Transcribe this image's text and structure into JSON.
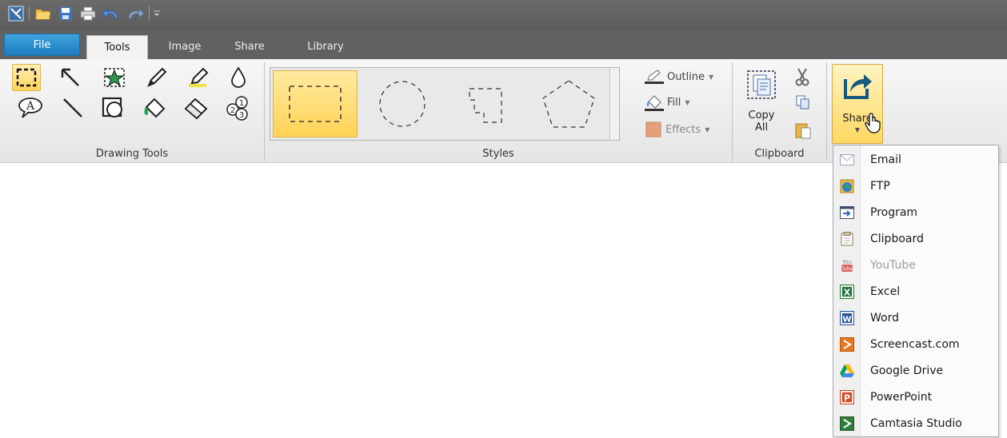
{
  "quick_access": {
    "icons": [
      "snagit-editor-icon",
      "open-folder-icon",
      "save-icon",
      "print-icon",
      "undo-icon",
      "redo-icon",
      "customize-dropdown-icon"
    ]
  },
  "tabs": [
    {
      "label": "File",
      "active": false
    },
    {
      "label": "Tools",
      "active": true
    },
    {
      "label": "Image",
      "active": false
    },
    {
      "label": "Share",
      "active": false
    },
    {
      "label": "Library",
      "active": false
    }
  ],
  "groups": {
    "drawing_tools": {
      "label": "Drawing Tools",
      "tools": [
        "selection-icon",
        "arrow-icon",
        "stamp-icon",
        "pen-icon",
        "highlighter-icon",
        "blur-icon",
        "callout-icon",
        "line-icon",
        "shape-icon",
        "fill-icon",
        "eraser-icon",
        "step-icon"
      ],
      "selected": "selection-icon"
    },
    "styles": {
      "label": "Styles",
      "outline_label": "Outline",
      "fill_label": "Fill",
      "effects_label": "Effects"
    },
    "clipboard": {
      "label": "Clipboard",
      "copy_all_label_1": "Copy",
      "copy_all_label_2": "All"
    },
    "share": {
      "button_label": "Share"
    }
  },
  "share_menu": {
    "items": [
      {
        "label": "Email",
        "icon": "email-icon",
        "enabled": true
      },
      {
        "label": "FTP",
        "icon": "ftp-icon",
        "enabled": true
      },
      {
        "label": "Program",
        "icon": "program-icon",
        "enabled": true
      },
      {
        "label": "Clipboard",
        "icon": "clipboard-icon",
        "enabled": true
      },
      {
        "label": "YouTube",
        "icon": "youtube-icon",
        "enabled": false
      },
      {
        "label": "Excel",
        "icon": "excel-icon",
        "enabled": true
      },
      {
        "label": "Word",
        "icon": "word-icon",
        "enabled": true
      },
      {
        "label": "Screencast.com",
        "icon": "screencast-icon",
        "enabled": true
      },
      {
        "label": "Google Drive",
        "icon": "google-drive-icon",
        "enabled": true
      },
      {
        "label": "PowerPoint",
        "icon": "powerpoint-icon",
        "enabled": true
      },
      {
        "label": "Camtasia Studio",
        "icon": "camtasia-icon",
        "enabled": true
      }
    ]
  },
  "colors": {
    "accent_blue": "#1d7cc0",
    "highlight_yellow": "#ffd45e"
  }
}
